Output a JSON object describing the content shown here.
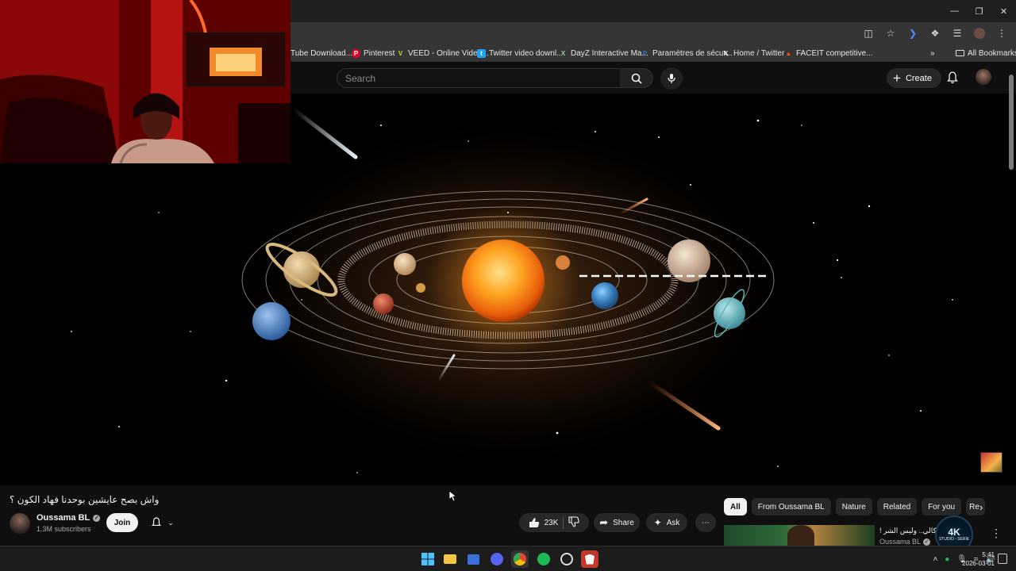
{
  "browser": {
    "bookmarks": [
      {
        "label": "Tube Download...",
        "icon": "youtube-downloader-icon",
        "color": "#cc0000"
      },
      {
        "label": "Pinterest",
        "icon": "pinterest-icon",
        "color": "#e60023"
      },
      {
        "label": "VEED - Online Video...",
        "icon": "veed-icon",
        "color": "#b5e61d"
      },
      {
        "label": "Twitter video downl...",
        "icon": "twitter-downloader-icon",
        "color": "#1da1f2"
      },
      {
        "label": "DayZ Interactive Ma...",
        "icon": "dayz-icon",
        "color": "#1a1a1a"
      },
      {
        "label": "Paramètres de sécur...",
        "icon": "paypal-icon",
        "color": "#003087"
      },
      {
        "label": "Home / Twitter",
        "icon": "x-icon",
        "color": "#000000"
      },
      {
        "label": "FACEIT competitive...",
        "icon": "faceit-icon",
        "color": "#ff5500"
      }
    ],
    "all_bookmarks_label": "All Bookmarks"
  },
  "masthead": {
    "search_placeholder": "Search",
    "create_label": "Create"
  },
  "video": {
    "title": "واش بصح عايشين بوحدنا فهاد الكون ؟",
    "channel_name": "Oussama BL",
    "subscribers": "1.3M subscribers",
    "join_label": "Join",
    "likes": "23K",
    "share_label": "Share",
    "ask_label": "Ask"
  },
  "chips": [
    "All",
    "From Oussama BL",
    "Nature",
    "Related",
    "For you",
    "Re"
  ],
  "recommendation": {
    "title": "جم التكالي.. وليس الشر !",
    "channel": "Oussama BL"
  },
  "overlay_logo": {
    "text": "4K",
    "subtext": "STUDIO - SERIE"
  },
  "taskbar": {
    "apps": [
      "windows-start-icon",
      "file-explorer-icon",
      "microsoft-store-icon",
      "discord-icon",
      "chrome-icon",
      "spotify-icon",
      "obs-icon",
      "brave-icon"
    ],
    "time": "5:41",
    "date": "2026-03-01"
  },
  "colors": {
    "accent": "#ff0000",
    "background": "#0f0f0f",
    "sun": "#ff9a1f"
  }
}
